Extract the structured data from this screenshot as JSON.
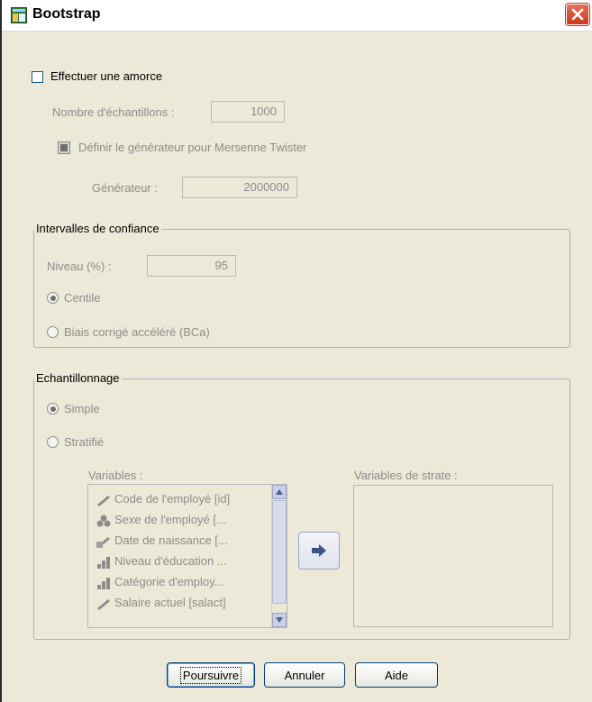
{
  "window": {
    "title": "Bootstrap"
  },
  "bootstrap": {
    "perform_label": "Effectuer une amorce",
    "samples_label": "Nombre d'échantillons :",
    "samples_value": "1000",
    "set_seed_label": "Définir le générateur pour Mersenne Twister",
    "seed_label": "Générateur :",
    "seed_value": "2000000"
  },
  "confidence": {
    "group_label": "Intervalles de confiance",
    "level_label": "Niveau (%) :",
    "level_value": "95",
    "percentile_label": "Centile",
    "bca_label": "Biais corrigé accéléré (BCa)"
  },
  "sampling": {
    "group_label": "Echantillonnage",
    "simple_label": "Simple",
    "stratified_label": "Stratifié",
    "variables_label": "Variables :",
    "strata_label": "Variables de strate :",
    "variables": [
      {
        "label": "Code de l'employé [id]",
        "icon": "scale-icon"
      },
      {
        "label": "Sexe de l'employé [...",
        "icon": "nominal-icon"
      },
      {
        "label": "Date de naissance [...",
        "icon": "scale-date-icon"
      },
      {
        "label": "Niveau d'éducation ...",
        "icon": "ordinal-icon"
      },
      {
        "label": "Catégorie d'employ...",
        "icon": "ordinal-icon"
      },
      {
        "label": "Salaire actuel [salact]",
        "icon": "scale-icon"
      }
    ]
  },
  "buttons": {
    "continue": "Poursuivre",
    "cancel": "Annuler",
    "help": "Aide"
  }
}
